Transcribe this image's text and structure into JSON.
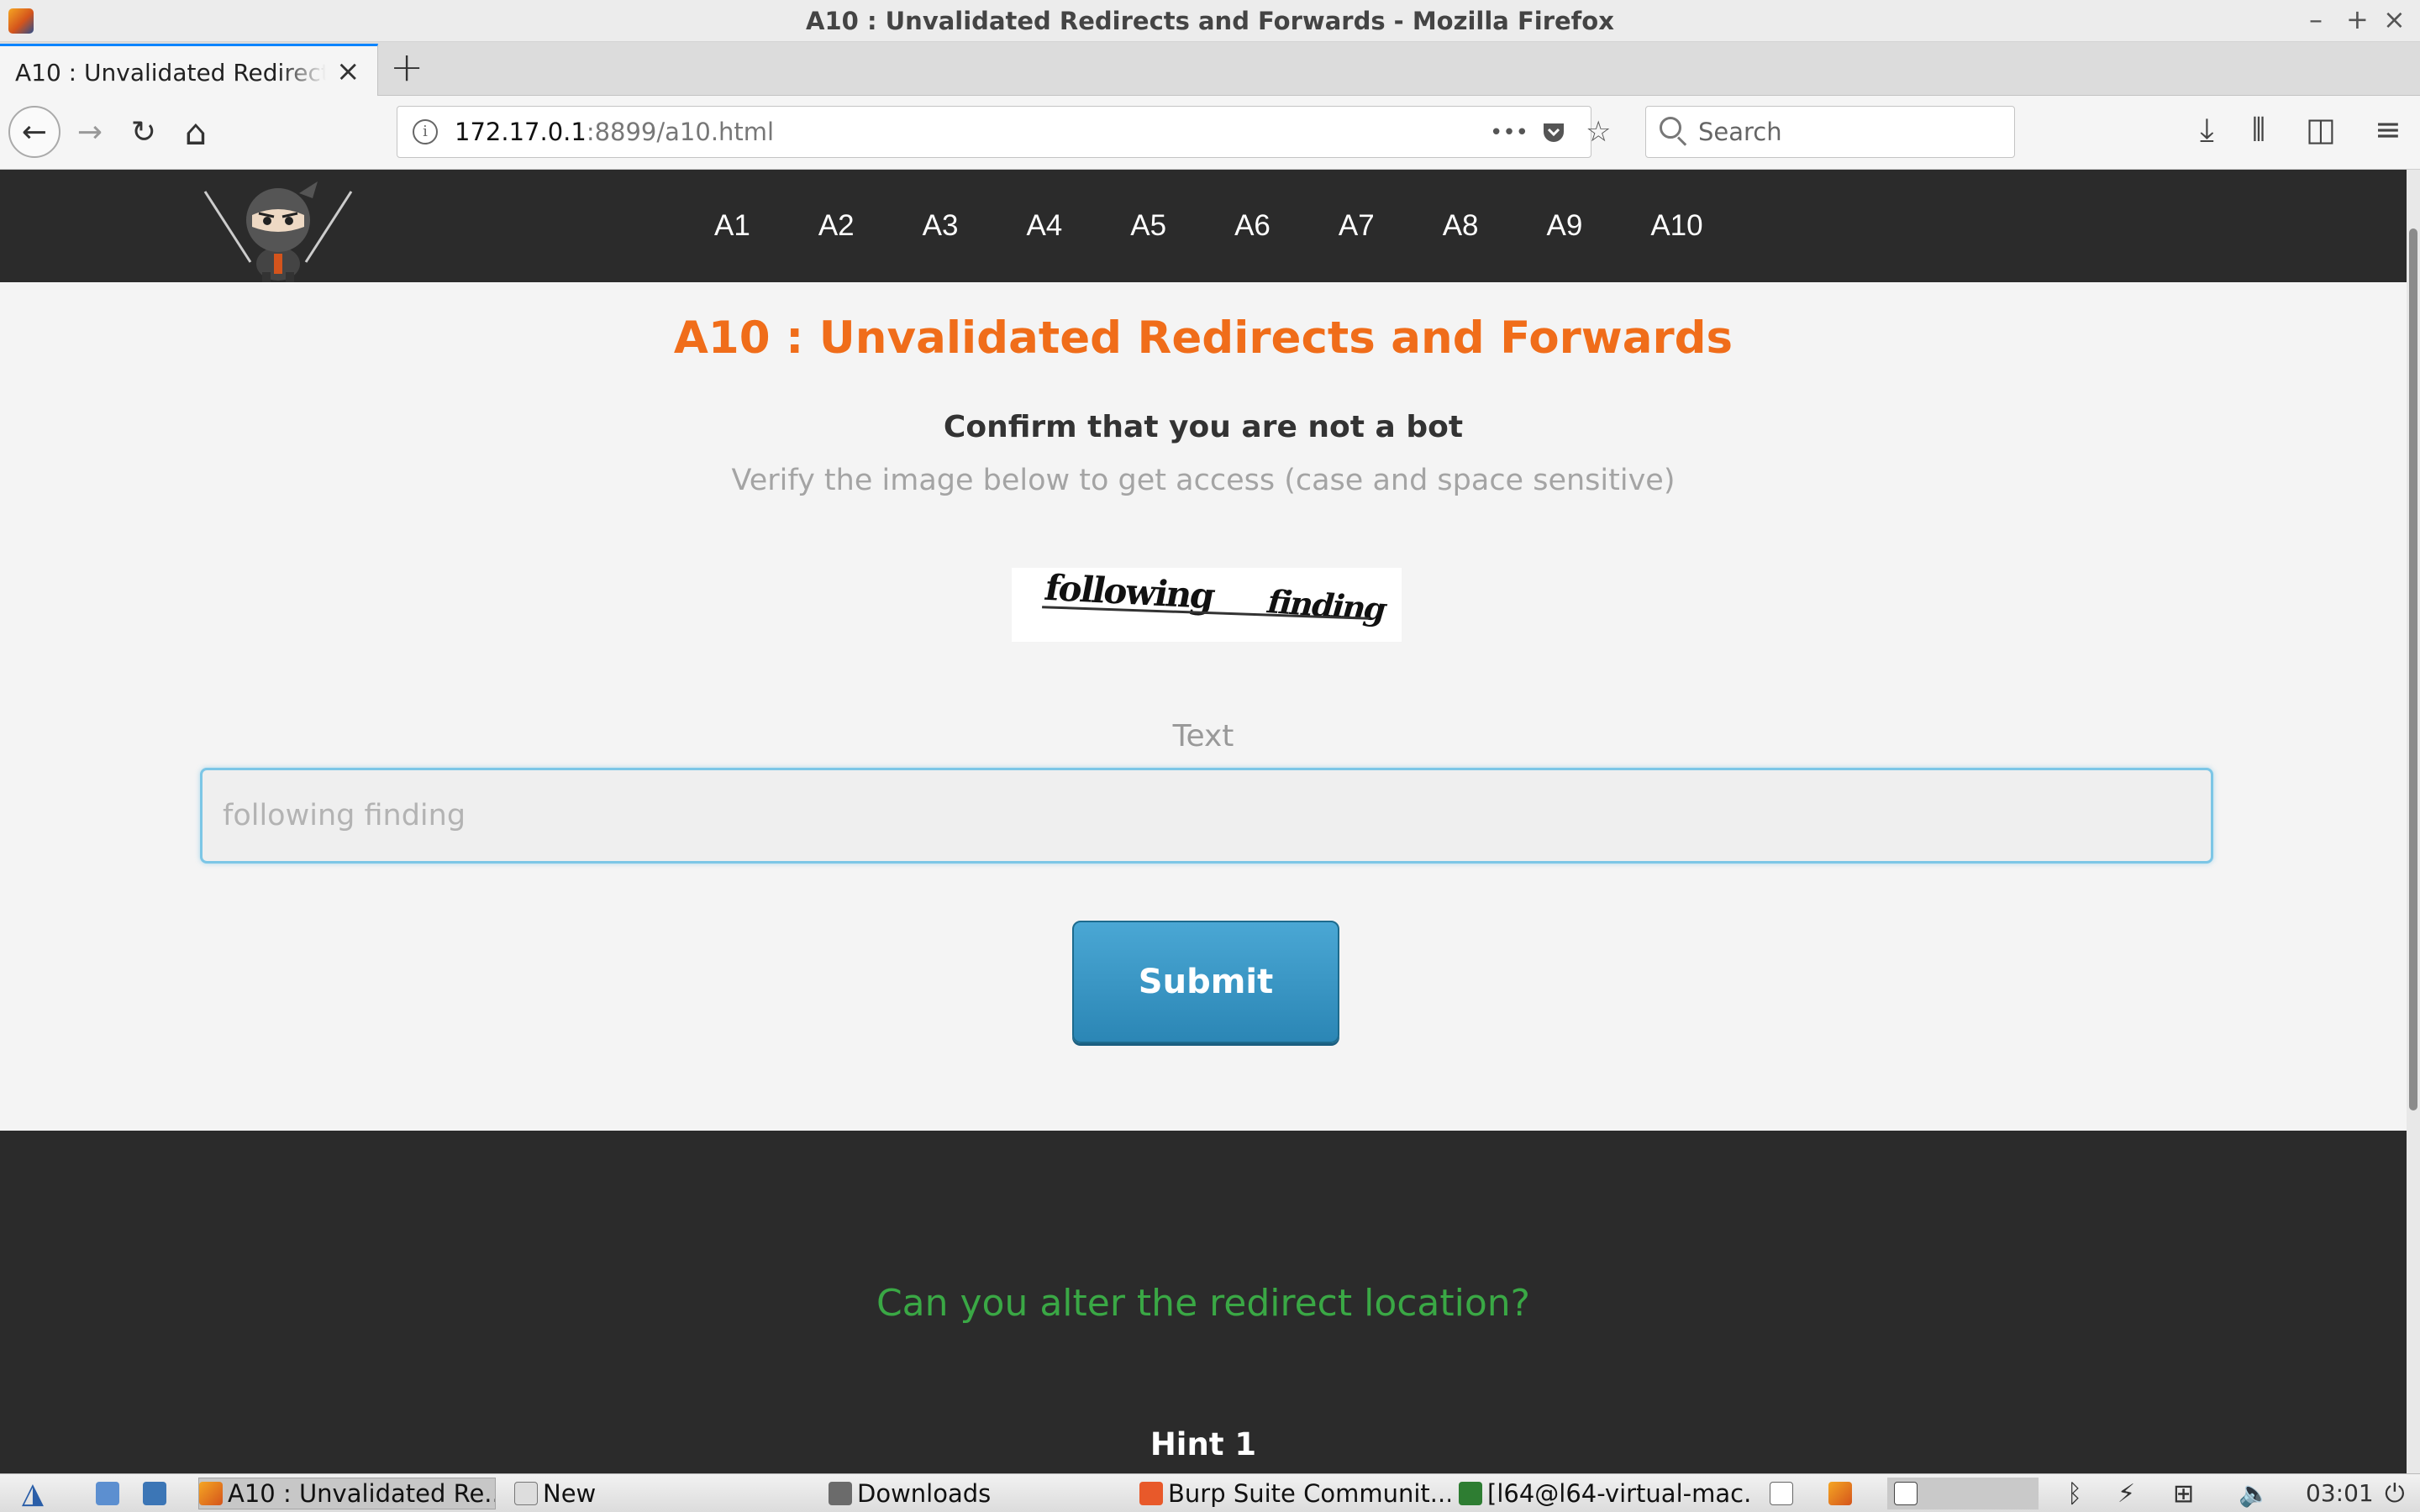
{
  "window": {
    "title": "A10 : Unvalidated Redirects and Forwards - Mozilla Firefox",
    "controls": [
      "–",
      "+",
      "×"
    ]
  },
  "tab": {
    "label": "A10 : Unvalidated Redirects and Forwards",
    "close": "×",
    "new_tab": "+"
  },
  "nav": {
    "back": "←",
    "forward": "→",
    "reload": "↻",
    "home": "⌂"
  },
  "address": {
    "info": "i",
    "host": "172.17.0.1",
    "path": ":8899/a10.html",
    "page_actions": "•••"
  },
  "search": {
    "placeholder": "Search"
  },
  "site_nav": {
    "links": [
      "A1",
      "A2",
      "A3",
      "A4",
      "A5",
      "A6",
      "A7",
      "A8",
      "A9",
      "A10"
    ]
  },
  "main": {
    "title": "A10 : Unvalidated Redirects and Forwards",
    "confirm_heading": "Confirm that you are not a bot",
    "instructions": "Verify the image below to get access (case and space sensitive)",
    "captcha_words": [
      "following",
      "finding"
    ],
    "text_label": "Text",
    "text_placeholder": "following finding",
    "submit_label": "Submit"
  },
  "hint": {
    "question": "Can you alter the redirect location?",
    "title": "Hint 1"
  },
  "taskbar": {
    "items": [
      "A10 : Unvalidated Re...",
      "New",
      "Downloads",
      "Burp Suite Communit...",
      "[l64@l64-virtual-mac..."
    ],
    "clock": "03:01"
  },
  "colors": {
    "accent_orange": "#f06d1a",
    "hint_green": "#3aa845",
    "submit_blue": "#3a97c7",
    "nav_dark": "#2b2b2b"
  }
}
